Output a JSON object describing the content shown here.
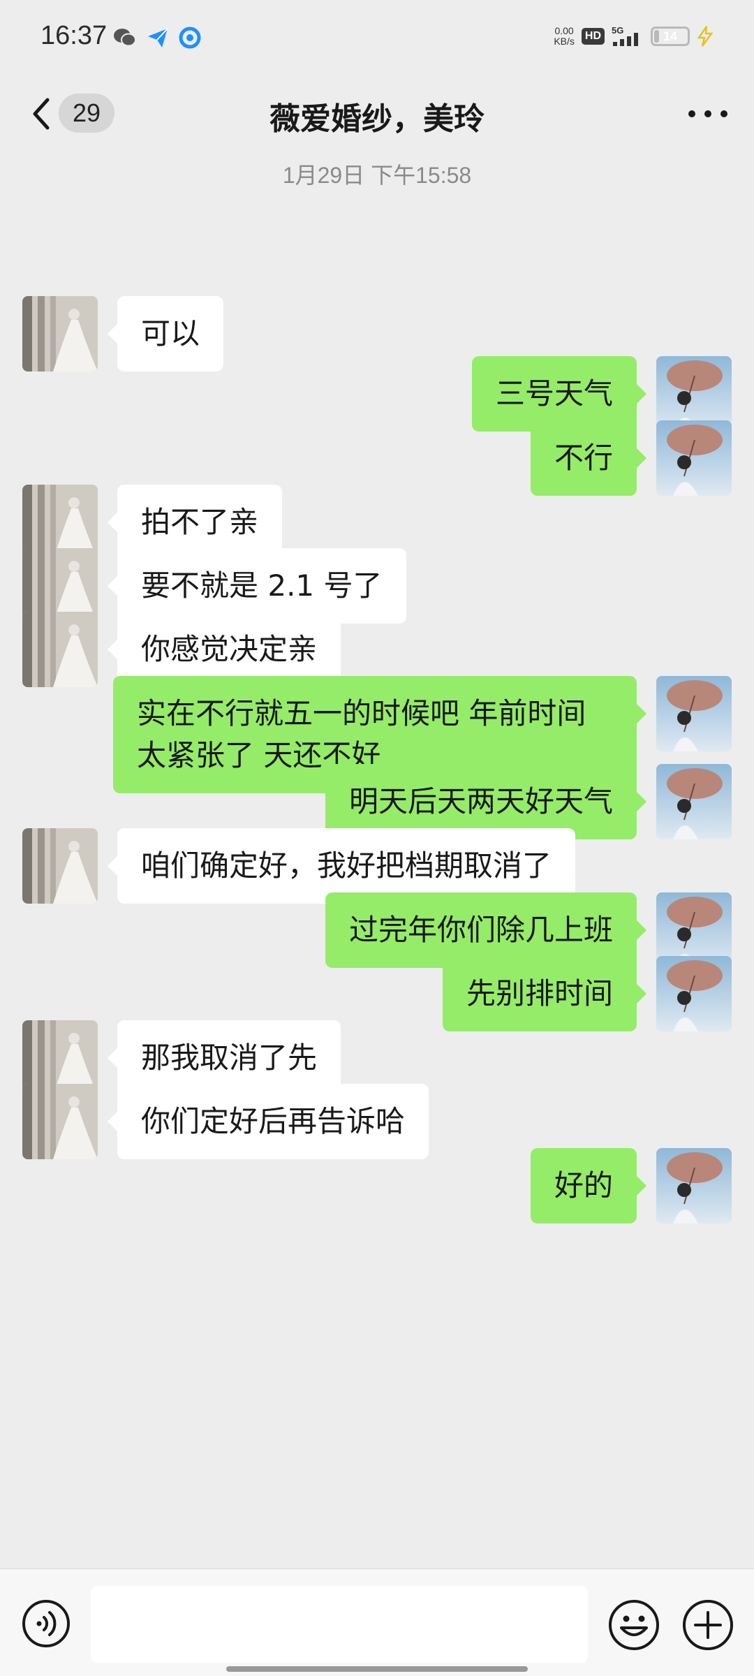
{
  "status_bar": {
    "time": "16:37",
    "net_speed_value": "0.00",
    "net_speed_unit": "KB/s",
    "hd_label": "HD",
    "network": "5G",
    "battery_level": "14",
    "battery_fraction": 0.14
  },
  "header": {
    "unread_count": "29",
    "title": "薇爱婚纱，美玲"
  },
  "timestamp": "1月29日 下午15:58",
  "messages": [
    {
      "side": "in",
      "text": "可以"
    },
    {
      "side": "out",
      "text": "三号天气"
    },
    {
      "side": "out",
      "text": "不行"
    },
    {
      "side": "in",
      "text": "拍不了亲"
    },
    {
      "side": "in",
      "text": "要不就是 2.1 号了"
    },
    {
      "side": "in",
      "text": "你感觉决定亲"
    },
    {
      "side": "out",
      "text": "实在不行就五一的时候吧  年前时间太紧张了  天还不好"
    },
    {
      "side": "out",
      "text": "明天后天两天好天气"
    },
    {
      "side": "in",
      "text": "咱们确定好，我好把档期取消了"
    },
    {
      "side": "out",
      "text": "过完年你们除几上班"
    },
    {
      "side": "out",
      "text": "先别排时间"
    },
    {
      "side": "in",
      "text": "那我取消了先"
    },
    {
      "side": "in",
      "text": "你们定好后再告诉哈"
    },
    {
      "side": "out",
      "text": "好的"
    }
  ],
  "input": {
    "value": "",
    "placeholder": ""
  },
  "icons": {
    "back": "chevron-left-icon",
    "more": "more-dots-icon",
    "voice": "voice-icon",
    "emoji": "emoji-icon",
    "plus": "plus-icon"
  },
  "colors": {
    "background": "#ededed",
    "outgoing_bubble": "#95ec69",
    "incoming_bubble": "#ffffff"
  }
}
